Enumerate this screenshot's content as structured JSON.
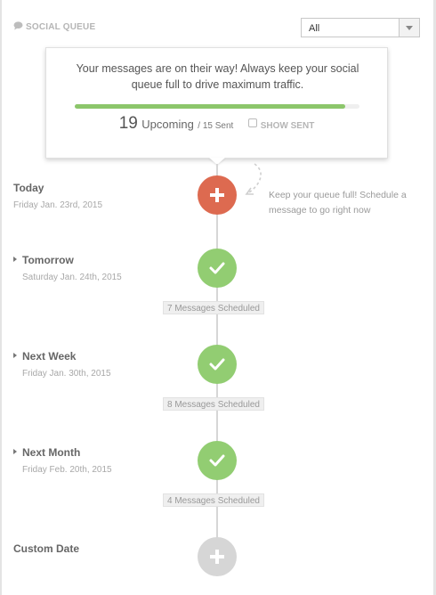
{
  "header": {
    "title": "SOCIAL QUEUE",
    "icon": "speech-bubble-icon"
  },
  "filter": {
    "selected": "All",
    "icon": "chevron-down-icon"
  },
  "status": {
    "message": "Your messages are on their way! Always keep your social queue full to drive maximum traffic.",
    "progress": 0.95,
    "upcoming_count": "19",
    "upcoming_label": "Upcoming",
    "sent_text": "/ 15 Sent",
    "show_sent_label": "SHOW SENT"
  },
  "timeline": {
    "today": {
      "title": "Today",
      "date": "Friday Jan. 23rd, 2015",
      "icon": "plus-icon"
    },
    "hint": "Keep your queue full! Schedule a message to go right now",
    "tomorrow": {
      "title": "Tomorrow",
      "date": "Saturday Jan. 24th, 2015",
      "badge": "7 Messages Scheduled",
      "icon": "check-icon"
    },
    "next_week": {
      "title": "Next Week",
      "date": "Friday Jan. 30th, 2015",
      "badge": "8 Messages Scheduled",
      "icon": "check-icon"
    },
    "next_month": {
      "title": "Next Month",
      "date": "Friday Feb. 20th, 2015",
      "badge": "4 Messages Scheduled",
      "icon": "check-icon"
    },
    "custom": {
      "title": "Custom Date",
      "icon": "plus-icon"
    }
  },
  "colors": {
    "accent_red": "#dd6a50",
    "accent_green": "#92cd72",
    "neutral_gray": "#d6d6d6",
    "progress_green": "#8cc66b"
  }
}
